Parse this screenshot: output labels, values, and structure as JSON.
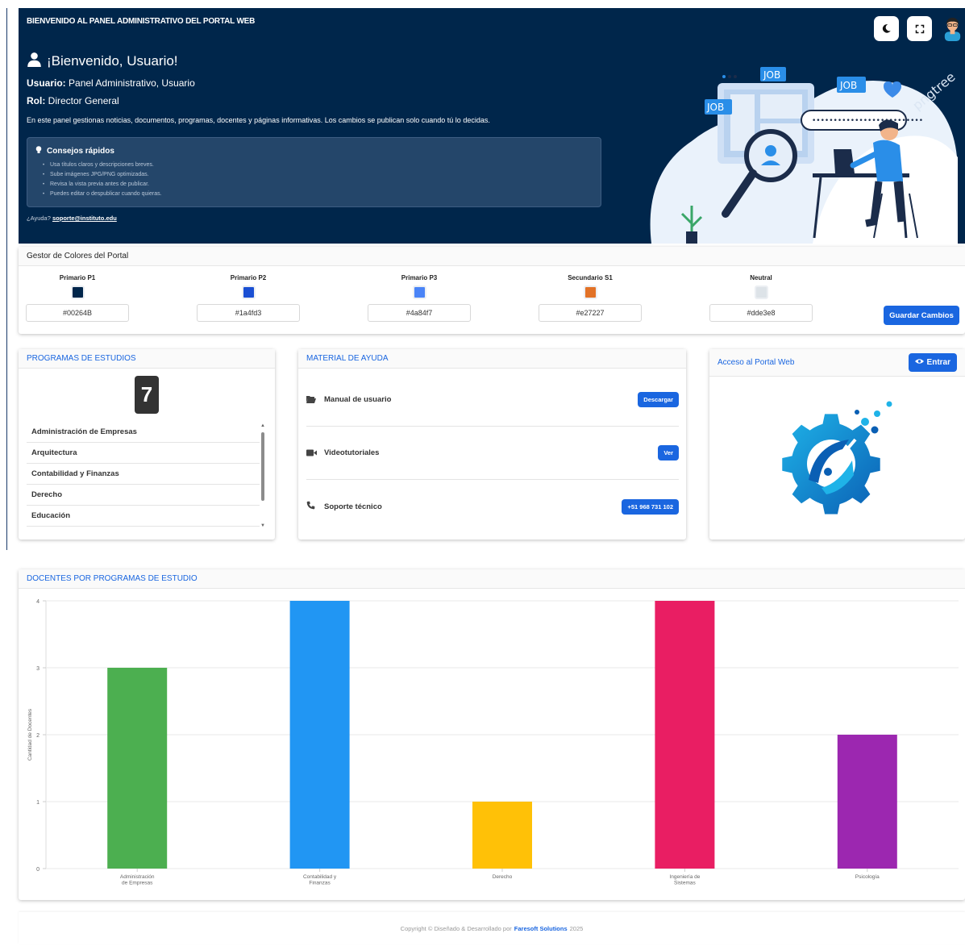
{
  "hero": {
    "title": "BIENVENIDO AL PANEL ADMINISTRATIVO DEL PORTAL WEB",
    "welcome": "¡Bienvenido, Usuario!",
    "user_label": "Usuario:",
    "user_value": "Panel Administrativo, Usuario",
    "role_label": "Rol:",
    "role_value": "Director General",
    "description": "En este panel gestionas noticias, documentos, programas, docentes y páginas informativas. Los cambios se publican solo cuando tú lo decidas.",
    "tips_title": "Consejos rápidos",
    "tips": [
      "Usa títulos claros y descripciones breves.",
      "Sube imágenes JPG/PNG optimizadas.",
      "Revisa la vista previa antes de publicar.",
      "Puedes editar o despublicar cuando quieras."
    ],
    "help_text": "¿Ayuda?",
    "help_email": "soporte@instituto.edu",
    "illustration": {
      "job_tags": [
        "JOB",
        "JOB",
        "JOB"
      ],
      "search_text": "••••••••••••••••••••••••••",
      "watermark": "pngtree"
    },
    "icons": {
      "dark_mode": "moon-icon",
      "fullscreen": "fullscreen-icon",
      "avatar": "user-avatar"
    }
  },
  "colors": {
    "title": "Gestor de Colores del Portal",
    "swatches": [
      {
        "label": "Primario P1",
        "value": "#00264B",
        "color": "#00264b"
      },
      {
        "label": "Primario P2",
        "value": "#1a4fd3",
        "color": "#1a4fd3"
      },
      {
        "label": "Primario P3",
        "value": "#4a84f7",
        "color": "#4a84f7"
      },
      {
        "label": "Secundario S1",
        "value": "#e27227",
        "color": "#e27227"
      },
      {
        "label": "Neutral",
        "value": "#dde3e8",
        "color": "#dde3e8"
      }
    ],
    "save_label": "Guardar Cambios"
  },
  "programs": {
    "title": "PROGRAMAS DE ESTUDIOS",
    "count": "7",
    "items": [
      "Administración de Empresas",
      "Arquitectura",
      "Contabilidad y Finanzas",
      "Derecho",
      "Educación"
    ]
  },
  "material": {
    "title": "MATERIAL DE AYUDA",
    "rows": [
      {
        "label": "Manual de usuario",
        "button": "Descargar",
        "icon": "folder-open-icon"
      },
      {
        "label": "Videotutoriales",
        "button": "Ver",
        "icon": "video-icon"
      },
      {
        "label": "Soporte técnico",
        "button": "+51 968 731 102",
        "icon": "phone-icon"
      }
    ]
  },
  "portal": {
    "title": "Acceso al Portal Web",
    "enter_label": "Entrar"
  },
  "chart_section": {
    "title": "DOCENTES POR PROGRAMAS DE ESTUDIO"
  },
  "chart_data": {
    "type": "bar",
    "title": "DOCENTES POR PROGRAMAS DE ESTUDIO",
    "xlabel": "",
    "ylabel": "Cantidad de Docentes",
    "categories": [
      [
        "Administración",
        "de Empresas"
      ],
      [
        "Contabilidad y",
        "Finanzas"
      ],
      [
        "Derecho"
      ],
      [
        "Ingeniería de",
        "Sistemas"
      ],
      [
        "Psicología"
      ]
    ],
    "values": [
      3,
      4,
      1,
      4,
      2
    ],
    "colors": [
      "#4caf50",
      "#2196f3",
      "#ffc107",
      "#e91e63",
      "#9c27b0"
    ],
    "ylim": [
      0,
      4
    ],
    "yticks": [
      "0",
      "1",
      "2",
      "3",
      "4"
    ],
    "grid": true
  },
  "footer": {
    "prefix": "Copyright © Diseñado & Desarrollado por",
    "company": "Faresoft Solutions",
    "year": "2025"
  }
}
